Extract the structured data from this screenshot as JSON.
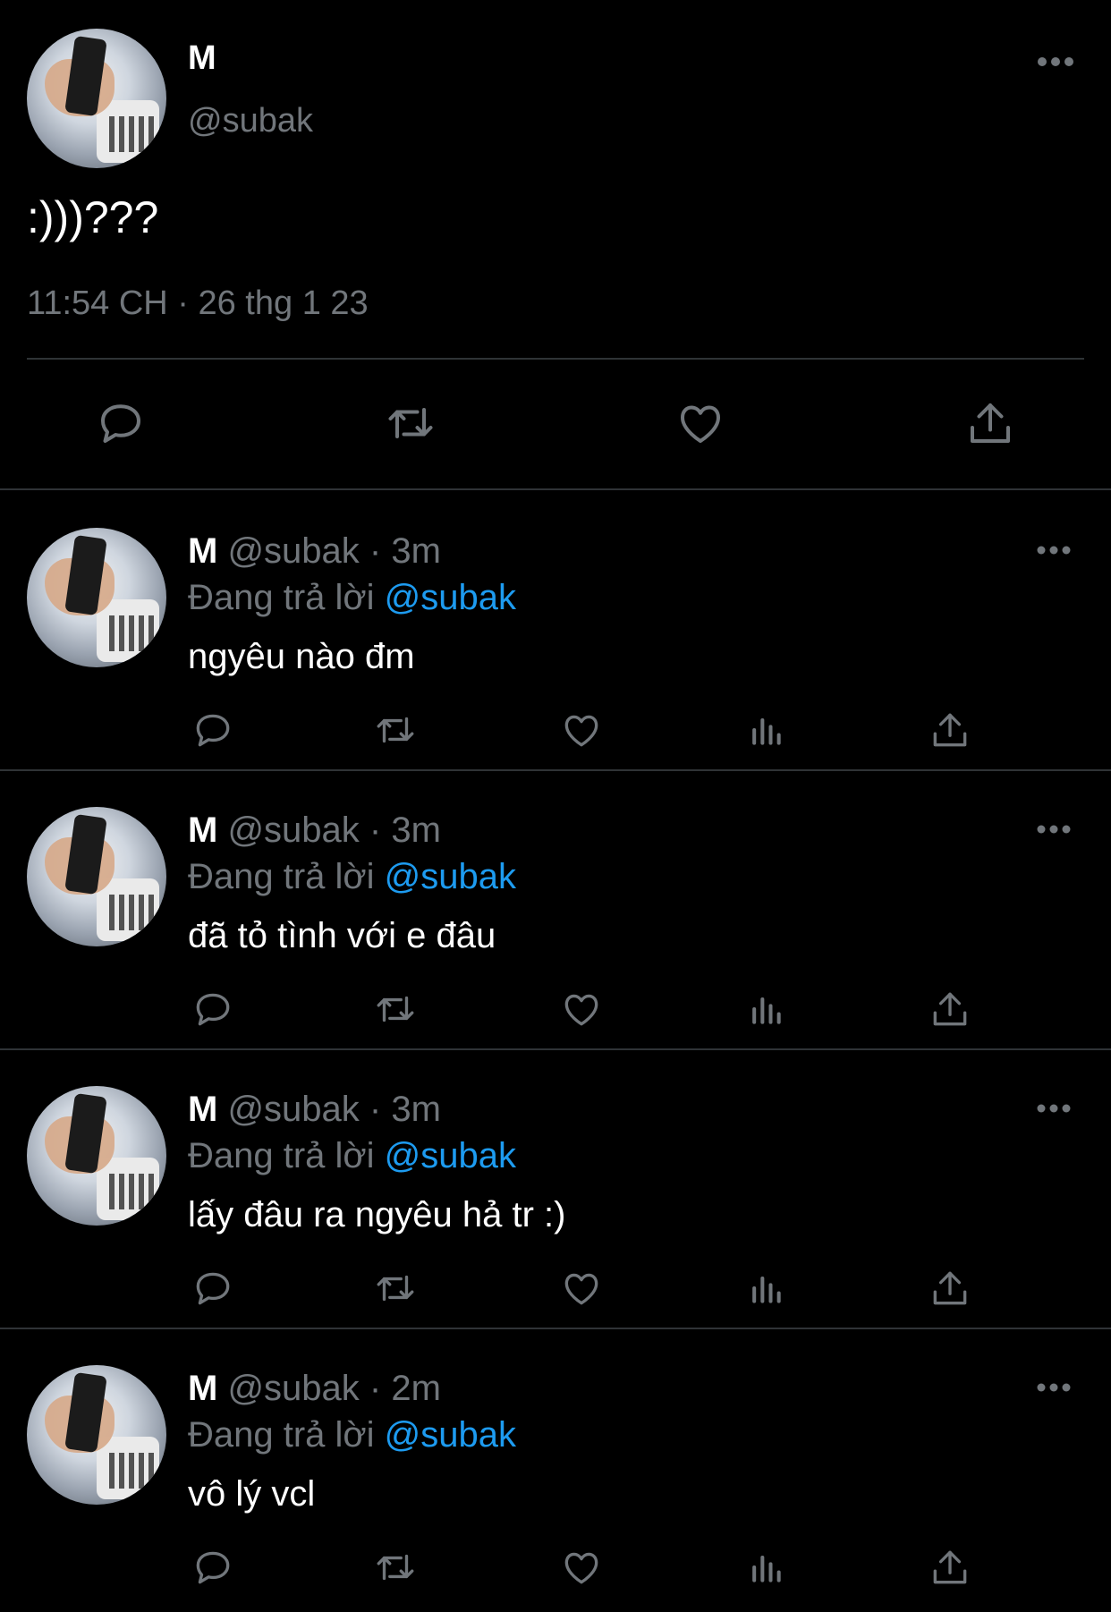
{
  "main_tweet": {
    "name": "M",
    "handle": "@subak",
    "text": ":)))???",
    "timestamp": "11:54 CH · 26 thg 1 23",
    "icons": [
      "reply-icon",
      "retweet-icon",
      "like-icon",
      "share-icon"
    ]
  },
  "replies": [
    {
      "name": "M",
      "handle": "@subak",
      "time": "3m",
      "replying_prefix": "Đang trả lời",
      "replying_to": "@subak",
      "text": "ngyêu nào đm"
    },
    {
      "name": "M",
      "handle": "@subak",
      "time": "3m",
      "replying_prefix": "Đang trả lời",
      "replying_to": "@subak",
      "text": "đã tỏ tình với e đâu"
    },
    {
      "name": "M",
      "handle": "@subak",
      "time": "3m",
      "replying_prefix": "Đang trả lời",
      "replying_to": "@subak",
      "text": "lấy đâu ra ngyêu hả tr :)"
    },
    {
      "name": "M",
      "handle": "@subak",
      "time": "2m",
      "replying_prefix": "Đang trả lời",
      "replying_to": "@subak",
      "text": "vô lý vcl"
    }
  ],
  "colors": {
    "background": "#000000",
    "text": "#e7e9ea",
    "muted": "#71767b",
    "link": "#1d9bf0",
    "divider": "#2f3336"
  }
}
